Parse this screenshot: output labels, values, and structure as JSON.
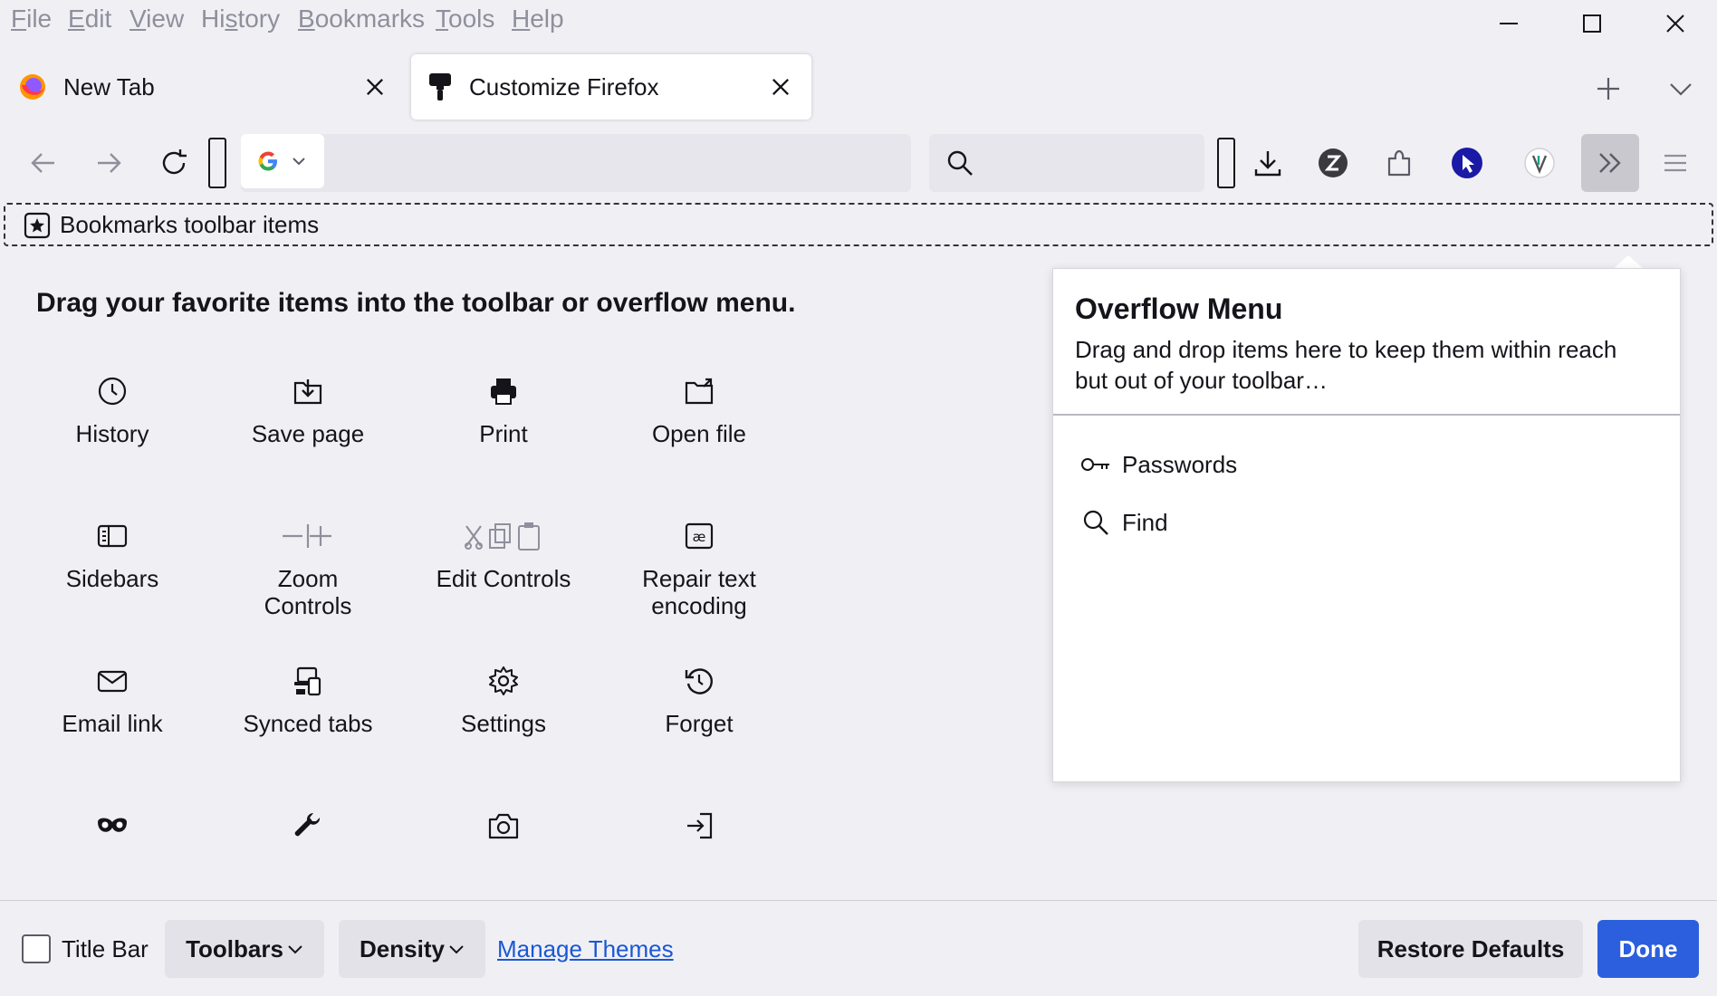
{
  "menubar": {
    "items": [
      {
        "label": "File",
        "accel": "F",
        "rest": "ile"
      },
      {
        "label": "Edit",
        "accel": "E",
        "rest": "dit"
      },
      {
        "label": "View",
        "accel": "V",
        "rest": "iew"
      },
      {
        "label": "History",
        "accel": "s",
        "pre": "Hi",
        "rest": "tory"
      },
      {
        "label": "Bookmarks",
        "accel": "B",
        "rest": "ookmarks"
      },
      {
        "label": "Tools",
        "accel": "T",
        "rest": "ools"
      },
      {
        "label": "Help",
        "accel": "H",
        "rest": "elp"
      }
    ]
  },
  "tabs": [
    {
      "title": "New Tab",
      "icon": "firefox-logo-icon",
      "active": false
    },
    {
      "title": "Customize Firefox",
      "icon": "paintbrush-icon",
      "active": true
    }
  ],
  "toolbar": {
    "bookmarks_items_label": "Bookmarks toolbar items"
  },
  "palette": {
    "heading": "Drag your favorite items into the toolbar or overflow menu.",
    "items": [
      {
        "label": "History",
        "icon": "clock-icon"
      },
      {
        "label": "Save page",
        "icon": "save-page-icon"
      },
      {
        "label": "Print",
        "icon": "printer-icon"
      },
      {
        "label": "Open file",
        "icon": "open-file-icon"
      },
      {
        "label": "Sidebars",
        "icon": "sidebar-icon"
      },
      {
        "label": "Zoom\nControls",
        "icon": "zoom-controls-icon"
      },
      {
        "label": "Edit Controls",
        "icon": "edit-controls-icon"
      },
      {
        "label": "Repair text\nencoding",
        "icon": "text-encoding-icon"
      },
      {
        "label": "Email link",
        "icon": "email-icon"
      },
      {
        "label": "Synced tabs",
        "icon": "synced-tabs-icon"
      },
      {
        "label": "Settings",
        "icon": "gear-icon"
      },
      {
        "label": "Forget",
        "icon": "forget-icon"
      },
      {
        "label": "",
        "icon": "private-mask-icon"
      },
      {
        "label": "",
        "icon": "wrench-icon"
      },
      {
        "label": "",
        "icon": "camera-icon"
      },
      {
        "label": "",
        "icon": "sign-in-icon"
      }
    ]
  },
  "overflow": {
    "title": "Overflow Menu",
    "description": "Drag and drop items here to keep them within reach but out of your toolbar…",
    "items": [
      {
        "label": "Passwords",
        "icon": "key-icon"
      },
      {
        "label": "Find",
        "icon": "search-icon"
      }
    ]
  },
  "bottom": {
    "title_bar_label": "Title Bar",
    "title_bar_checked": false,
    "toolbars_label": "Toolbars",
    "density_label": "Density",
    "manage_themes_label": "Manage Themes",
    "restore_defaults_label": "Restore Defaults",
    "done_label": "Done"
  },
  "colors": {
    "accent": "#2c5fdd",
    "link": "#1a57d6",
    "background": "#f0f0f4"
  }
}
